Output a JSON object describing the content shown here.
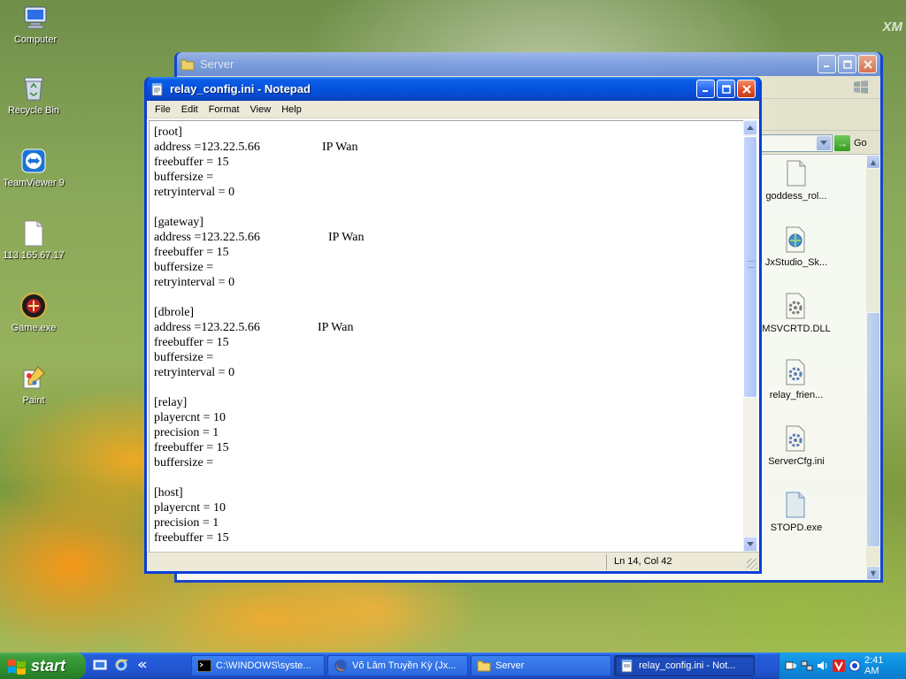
{
  "desktop": {
    "brand": "XM",
    "icons": [
      {
        "label": "Computer",
        "icon": "computer-icon"
      },
      {
        "label": "Recycle Bin",
        "icon": "recycle-bin-icon"
      },
      {
        "label": "TeamViewer 9",
        "icon": "teamviewer-icon"
      },
      {
        "label": "113.165.67.17",
        "icon": "file-icon"
      },
      {
        "label": "Game.exe",
        "icon": "game-icon"
      },
      {
        "label": "Paint",
        "icon": "paint-icon"
      }
    ]
  },
  "explorer": {
    "title": "Server",
    "go_label": "Go",
    "files": [
      {
        "name": "goddess_rol...",
        "icon": "blank-file-icon"
      },
      {
        "name": "JxStudio_Sk...",
        "icon": "web-file-icon"
      },
      {
        "name": "MSVCRTD.DLL",
        "icon": "dll-file-icon"
      },
      {
        "name": "relay_frien...",
        "icon": "config-file-icon"
      },
      {
        "name": "ServerCfg.ini",
        "icon": "config-file-icon"
      },
      {
        "name": "STOPD.exe",
        "icon": "exe-file-icon"
      }
    ]
  },
  "notepad": {
    "title": "relay_config.ini - Notepad",
    "menu": [
      "File",
      "Edit",
      "Format",
      "View",
      "Help"
    ],
    "lines": [
      {
        "text": "[root]",
        "note": ""
      },
      {
        "text": "address =123.22.5.66",
        "note": "IP Wan"
      },
      {
        "text": "freebuffer = 15",
        "note": ""
      },
      {
        "text": "buffersize =",
        "note": ""
      },
      {
        "text": "retryinterval = 0",
        "note": ""
      },
      {
        "text": "",
        "note": ""
      },
      {
        "text": "[gateway]",
        "note": ""
      },
      {
        "text": "address =123.22.5.66",
        "note": "IP Wan"
      },
      {
        "text": "freebuffer = 15",
        "note": ""
      },
      {
        "text": "buffersize =",
        "note": ""
      },
      {
        "text": "retryinterval = 0",
        "note": ""
      },
      {
        "text": "",
        "note": ""
      },
      {
        "text": "[dbrole]",
        "note": ""
      },
      {
        "text": "address =123.22.5.66",
        "note": "IP Wan"
      },
      {
        "text": "freebuffer = 15",
        "note": ""
      },
      {
        "text": "buffersize =",
        "note": ""
      },
      {
        "text": "retryinterval = 0",
        "note": ""
      },
      {
        "text": "",
        "note": ""
      },
      {
        "text": "[relay]",
        "note": ""
      },
      {
        "text": "playercnt = 10",
        "note": ""
      },
      {
        "text": "precision = 1",
        "note": ""
      },
      {
        "text": "freebuffer = 15",
        "note": ""
      },
      {
        "text": "buffersize =",
        "note": ""
      },
      {
        "text": "",
        "note": ""
      },
      {
        "text": "[host]",
        "note": ""
      },
      {
        "text": "playercnt = 10",
        "note": ""
      },
      {
        "text": "precision = 1",
        "note": ""
      },
      {
        "text": "freebuffer = 15",
        "note": ""
      }
    ],
    "status": "Ln 14, Col 42"
  },
  "taskbar": {
    "start_label": "start",
    "tasks": [
      {
        "label": "C:\\WINDOWS\\syste...",
        "icon": "console-icon",
        "active": false
      },
      {
        "label": "Võ Lâm Truyền Kỳ (Jx...",
        "icon": "firefox-icon",
        "active": false
      },
      {
        "label": "Server",
        "icon": "folder-icon",
        "active": false
      },
      {
        "label": "relay_config.ini - Not...",
        "icon": "notepad-icon",
        "active": true
      }
    ],
    "clock": "2:41 AM"
  }
}
